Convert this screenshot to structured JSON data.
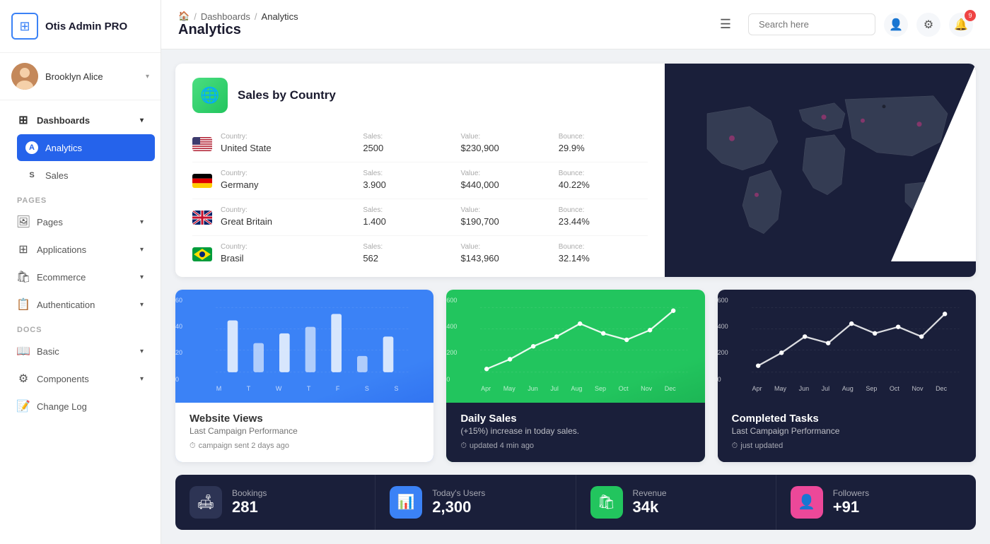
{
  "sidebar": {
    "logo": {
      "text": "Otis Admin PRO",
      "icon": "⊞"
    },
    "user": {
      "name": "Brooklyn Alice",
      "avatar_initials": "BA"
    },
    "nav": [
      {
        "id": "dashboards",
        "label": "Dashboards",
        "icon": "⊞",
        "active": false,
        "expanded": true,
        "children": [
          {
            "id": "analytics",
            "label": "Analytics",
            "icon": "A",
            "active": true
          },
          {
            "id": "sales",
            "label": "Sales",
            "icon": "S",
            "active": false
          }
        ]
      }
    ],
    "sections": [
      {
        "label": "PAGES",
        "items": [
          {
            "id": "pages",
            "label": "Pages",
            "icon": "🖼"
          },
          {
            "id": "applications",
            "label": "Applications",
            "icon": "⊞"
          },
          {
            "id": "ecommerce",
            "label": "Ecommerce",
            "icon": "🛍"
          },
          {
            "id": "authentication",
            "label": "Authentication",
            "icon": "📋"
          }
        ]
      },
      {
        "label": "DOCS",
        "items": [
          {
            "id": "basic",
            "label": "Basic",
            "icon": "📖"
          },
          {
            "id": "components",
            "label": "Components",
            "icon": "⚙"
          },
          {
            "id": "changelog",
            "label": "Change Log",
            "icon": "📝"
          }
        ]
      }
    ]
  },
  "topbar": {
    "hamburger": "☰",
    "breadcrumb": {
      "home": "🏠",
      "parent": "Dashboards",
      "current": "Analytics"
    },
    "page_title": "Analytics",
    "search_placeholder": "Search here",
    "notification_count": "9"
  },
  "sales_country": {
    "title": "Sales by Country",
    "icon": "🌐",
    "columns": {
      "country": "Country:",
      "sales": "Sales:",
      "value": "Value:",
      "bounce": "Bounce:"
    },
    "rows": [
      {
        "flag": "us",
        "country": "United State",
        "sales": "2500",
        "value": "$230,900",
        "bounce": "29.9%"
      },
      {
        "flag": "de",
        "country": "Germany",
        "sales": "3.900",
        "value": "$440,000",
        "bounce": "40.22%"
      },
      {
        "flag": "gb",
        "country": "Great Britain",
        "sales": "1.400",
        "value": "$190,700",
        "bounce": "23.44%"
      },
      {
        "flag": "br",
        "country": "Brasil",
        "sales": "562",
        "value": "$143,960",
        "bounce": "32.14%"
      }
    ]
  },
  "charts": {
    "website_views": {
      "title": "Website Views",
      "subtitle": "Last Campaign Performance",
      "time_label": "campaign sent 2 days ago",
      "y_labels": [
        "60",
        "40",
        "20",
        "0"
      ],
      "x_labels": [
        "M",
        "T",
        "W",
        "T",
        "F",
        "S",
        "S"
      ]
    },
    "daily_sales": {
      "title": "Daily Sales",
      "subtitle": "(+15%) increase in today sales.",
      "time_label": "updated 4 min ago",
      "y_labels": [
        "600",
        "400",
        "200",
        "0"
      ],
      "x_labels": [
        "Apr",
        "May",
        "Jun",
        "Jul",
        "Aug",
        "Sep",
        "Oct",
        "Nov",
        "Dec"
      ]
    },
    "completed_tasks": {
      "title": "Completed Tasks",
      "subtitle": "Last Campaign Performance",
      "time_label": "just updated",
      "y_labels": [
        "600",
        "400",
        "200",
        "0"
      ],
      "x_labels": [
        "Apr",
        "May",
        "Jun",
        "Jul",
        "Aug",
        "Sep",
        "Oct",
        "Nov",
        "Dec"
      ]
    }
  },
  "stats": [
    {
      "id": "bookings",
      "icon": "🛋",
      "icon_style": "dark",
      "label": "Bookings",
      "value": "281"
    },
    {
      "id": "today_users",
      "icon": "📊",
      "icon_style": "blue",
      "label": "Today's Users",
      "value": "2,300"
    },
    {
      "id": "revenue",
      "icon": "🛍",
      "icon_style": "green",
      "label": "Revenue",
      "value": "34k"
    },
    {
      "id": "followers",
      "icon": "👤",
      "icon_style": "pink",
      "label": "Followers",
      "value": "+91"
    }
  ]
}
